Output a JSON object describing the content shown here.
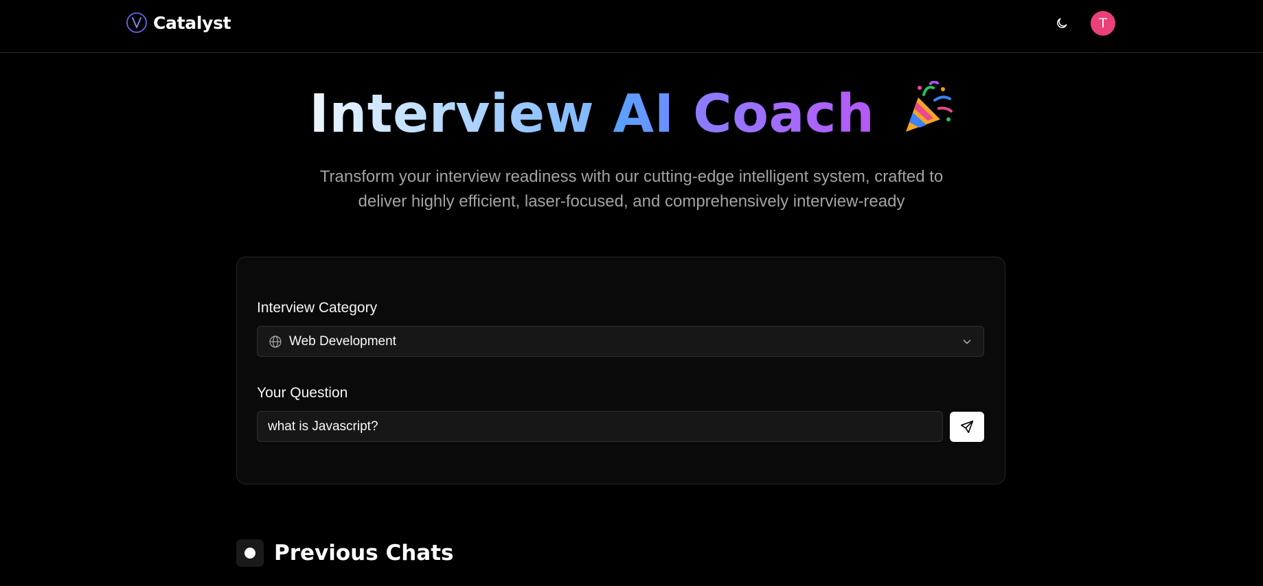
{
  "header": {
    "brand_name": "Catalyst",
    "avatar_initial": "T",
    "avatar_color": "#ec407a",
    "logo_icon": "v-circle-logo-icon",
    "theme_icon": "moon-icon"
  },
  "hero": {
    "title_word_1": "Interview",
    "title_word_2": "AI",
    "title_word_3": "Coach",
    "title_emoji": "🎉",
    "subtitle": "Transform your interview readiness with our cutting-edge intelligent system, crafted to deliver highly efficient, laser-focused, and comprehensively interview-ready"
  },
  "form": {
    "category_label": "Interview Category",
    "category_value": "Web Development",
    "category_icon": "globe-icon",
    "question_label": "Your Question",
    "question_value": "what is Javascript?",
    "send_icon": "send-icon"
  },
  "previous_chats": {
    "title": "Previous Chats"
  },
  "colors": {
    "background": "#000000",
    "card": "#0a0a0a",
    "border": "#262626",
    "subtitle": "#a3a3a3",
    "accent_purple": "#6366f1"
  }
}
